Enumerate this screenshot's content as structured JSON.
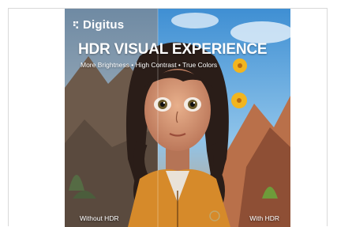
{
  "product_image": {
    "brand": "Digitus",
    "headline": "HDR VISUAL EXPERIENCE",
    "subline": "More Brightness • High Contrast • True Colors",
    "label_left": "Without HDR",
    "label_right": "With HDR"
  },
  "colors": {
    "sky_with_hdr": "#4a9ad6",
    "sky_without_hdr": "#7e95a8",
    "flower": "#f2b51f",
    "jacket": "#d68a2a"
  }
}
